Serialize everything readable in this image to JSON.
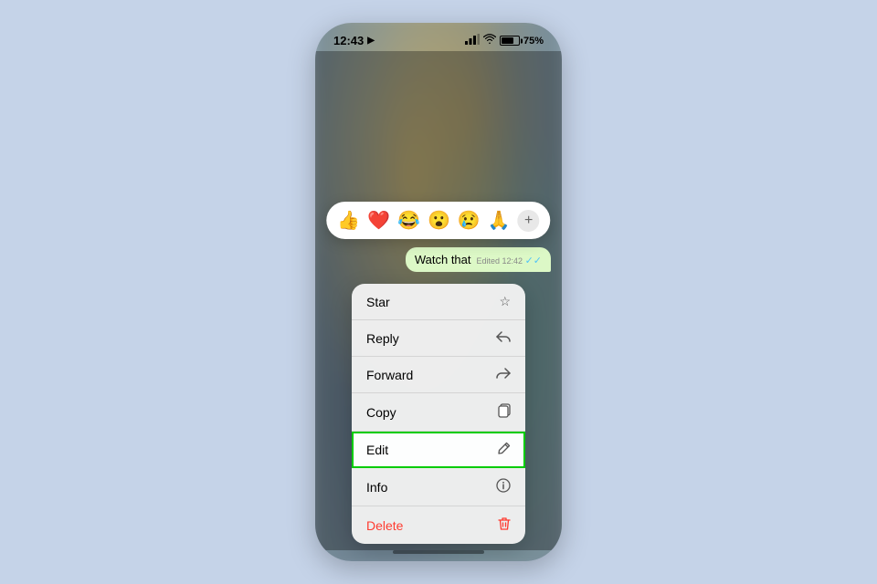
{
  "status_bar": {
    "time": "12:43",
    "signal": "●●●",
    "wifi": "wifi",
    "battery": "75%"
  },
  "emoji_bar": {
    "emojis": [
      "👍",
      "❤️",
      "😂",
      "😮",
      "😢",
      "🙏"
    ],
    "plus_label": "+"
  },
  "message": {
    "text": "Watch that",
    "meta": "Edited 12:42",
    "ticks": "✓✓"
  },
  "context_menu": {
    "items": [
      {
        "label": "Star",
        "icon": "☆",
        "type": "normal"
      },
      {
        "label": "Reply",
        "icon": "↩",
        "type": "normal"
      },
      {
        "label": "Forward",
        "icon": "↪",
        "type": "normal"
      },
      {
        "label": "Copy",
        "icon": "⧉",
        "type": "normal"
      },
      {
        "label": "Edit",
        "icon": "✎",
        "type": "edit"
      },
      {
        "label": "Info",
        "icon": "ⓘ",
        "type": "normal"
      },
      {
        "label": "Delete",
        "icon": "🗑",
        "type": "delete"
      }
    ]
  },
  "home_indicator": {
    "label": "home-bar"
  }
}
